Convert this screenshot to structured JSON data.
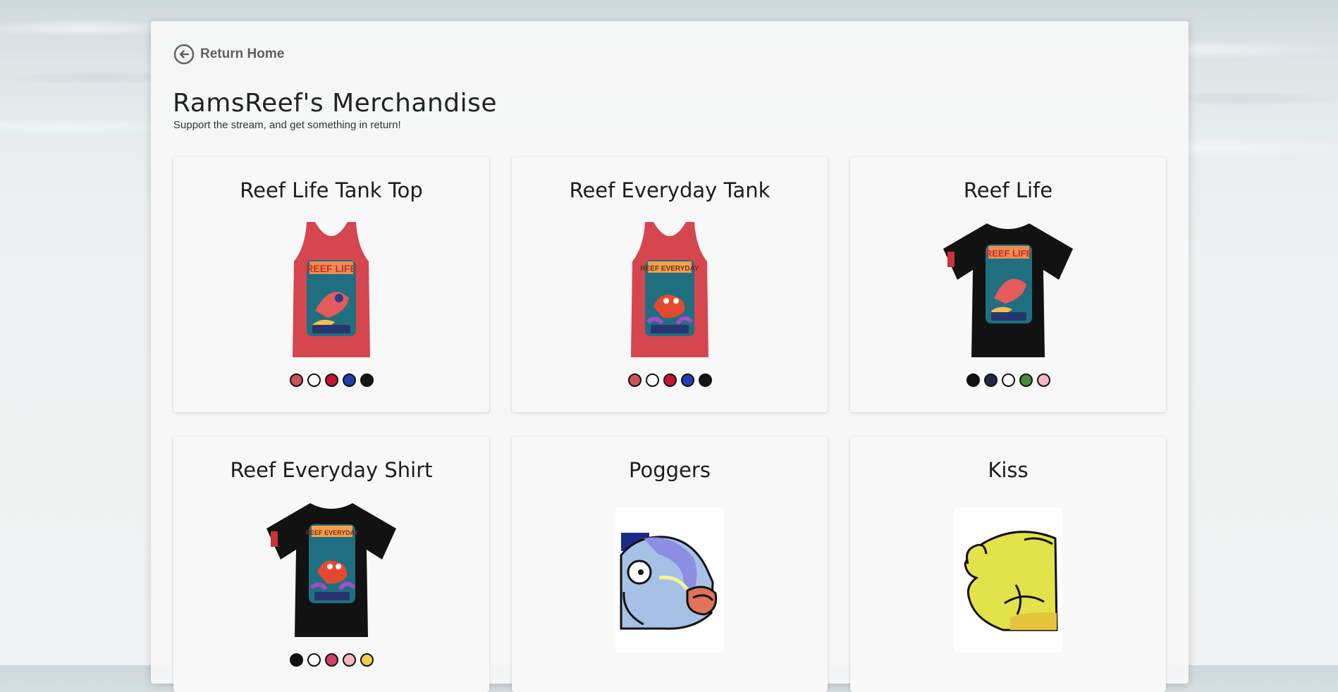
{
  "nav": {
    "return_label": "Return Home"
  },
  "page": {
    "title": "RamsReef's Merchandise",
    "subtitle": "Support the stream, and get something in return!"
  },
  "products": [
    {
      "title": "Reef Life Tank Top",
      "kind": "tank",
      "color": "#d5464f",
      "print": "REEF LIFE",
      "swatches": [
        "#d0505a",
        "#ffffff",
        "#c5162b",
        "#1f3eb0",
        "#151515"
      ]
    },
    {
      "title": "Reef Everyday Tank",
      "kind": "tank",
      "color": "#d5464f",
      "print": "REEF EVERYDAY",
      "swatches": [
        "#d0505a",
        "#ffffff",
        "#c5162b",
        "#1f3eb0",
        "#151515"
      ]
    },
    {
      "title": "Reef Life",
      "kind": "tee",
      "color": "#111111",
      "print": "REEF LIFE",
      "swatches": [
        "#111111",
        "#22274a",
        "#ffffff",
        "#4a8b3a",
        "#f6b7bf"
      ]
    },
    {
      "title": "Reef Everyday Shirt",
      "kind": "tee",
      "color": "#111111",
      "print": "REEF EVERYDAY",
      "swatches": [
        "#111111",
        "#ffffff",
        "#d2416a",
        "#f6b7bf",
        "#f3cf4f"
      ]
    },
    {
      "title": "Poggers",
      "kind": "emote-fish"
    },
    {
      "title": "Kiss",
      "kind": "emote-kiss"
    }
  ],
  "icons": {
    "back": "arrow-left-circle-icon"
  }
}
